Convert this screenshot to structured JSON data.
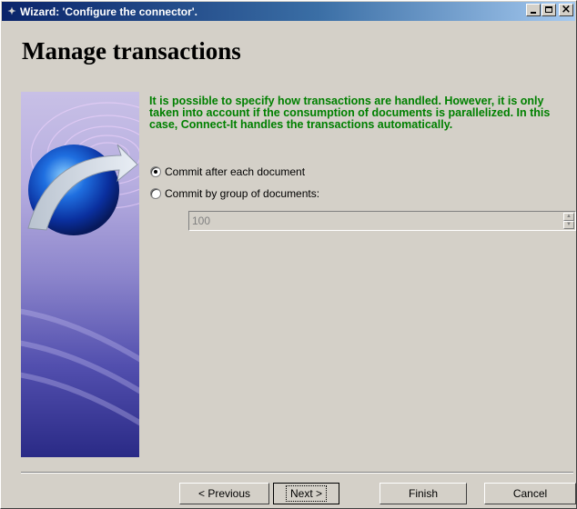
{
  "window": {
    "title": "Wizard: 'Configure the connector'.",
    "title_icon": "wizard-wand-icon"
  },
  "header": {
    "title": "Manage transactions"
  },
  "content": {
    "description": "It is possible to specify how transactions are handled. However, it is only taken into account if the consumption of documents is parallelized. In this case, Connect-It handles the transactions automatically.",
    "options": [
      {
        "label": "Commit after each document",
        "checked": true
      },
      {
        "label": "Commit by group of documents:",
        "checked": false
      }
    ],
    "group_size": "100"
  },
  "buttons": {
    "previous": "< Previous",
    "next": "Next >",
    "finish": "Finish",
    "cancel": "Cancel"
  },
  "colors": {
    "description_text": "#008000",
    "titlebar_start": "#0a246a",
    "titlebar_end": "#a6caf0",
    "dialog_face": "#d4d0c8"
  }
}
